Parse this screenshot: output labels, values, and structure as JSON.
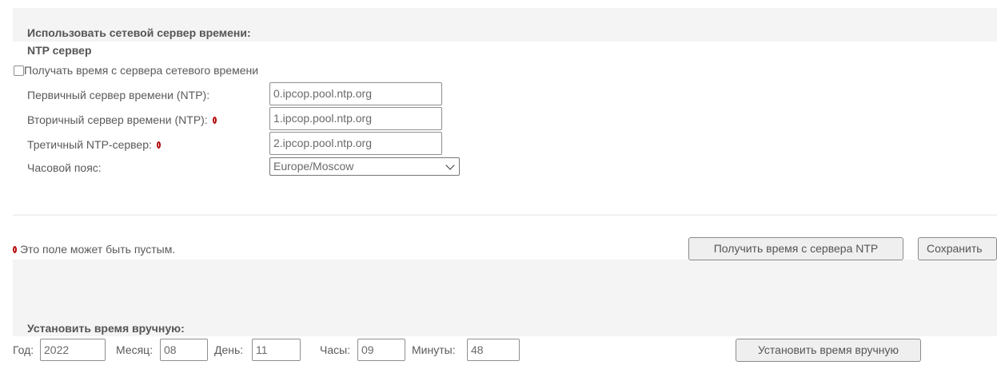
{
  "ntp_section": {
    "title": "Использовать сетевой сервер времени:",
    "subtitle": "NTP сервер",
    "checkbox_label": "Получать время с сервера сетевого времени",
    "primary_label": "Первичный сервер времени (NTP):",
    "primary_value": "0.ipcop.pool.ntp.org",
    "secondary_label": "Вторичный сервер времени (NTP):",
    "secondary_value": "1.ipcop.pool.ntp.org",
    "tertiary_label": "Третичный NTP-сервер:",
    "tertiary_value": "2.ipcop.pool.ntp.org",
    "timezone_label": "Часовой пояс:",
    "timezone_value": "Europe/Moscow"
  },
  "footer": {
    "note": "Это поле может быть пустым.",
    "get_time_button": "Получить время с сервера NTP",
    "save_button": "Сохранить"
  },
  "manual_section": {
    "title": "Установить время вручную:",
    "year_label": "Год:",
    "year_value": "2022",
    "month_label": "Месяц:",
    "month_value": "08",
    "day_label": "День:",
    "day_value": "11",
    "hours_label": "Часы:",
    "hours_value": "09",
    "minutes_label": "Минуты:",
    "minutes_value": "48",
    "set_button": "Установить время вручную"
  },
  "colors": {
    "band": "#f4f4f4",
    "required_marker": "#b30000"
  }
}
